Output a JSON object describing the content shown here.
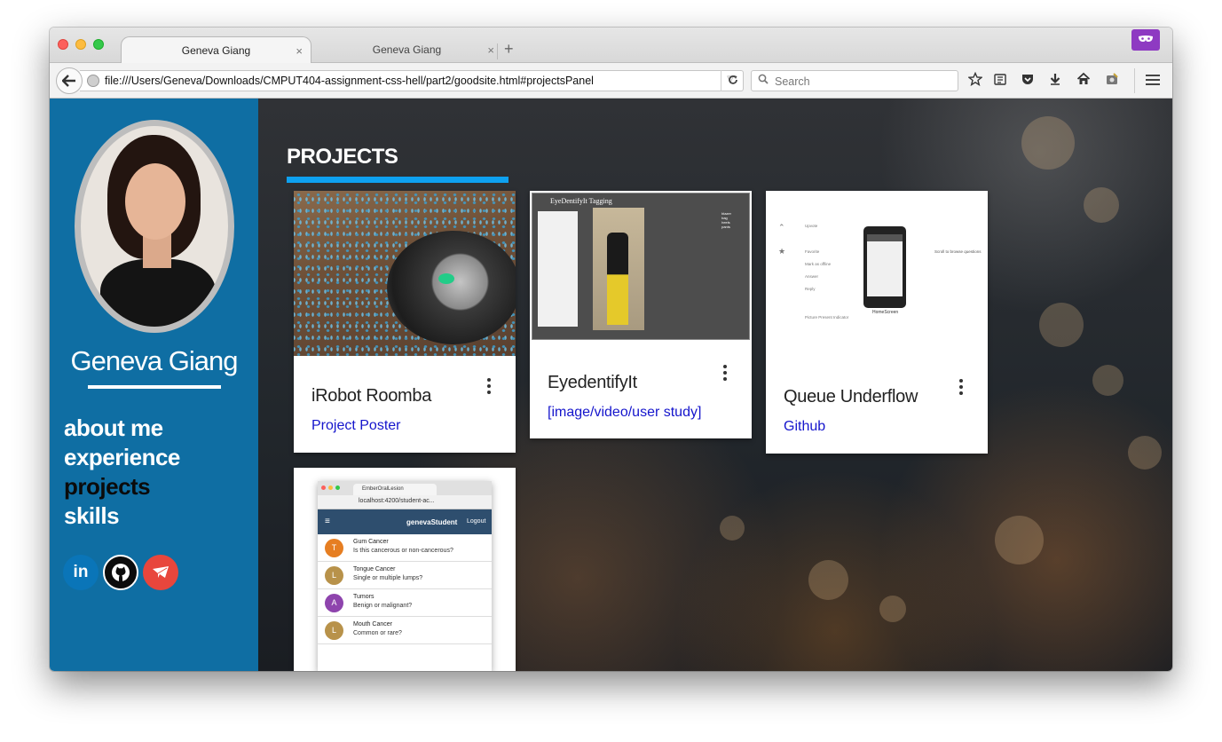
{
  "browser": {
    "tabs": [
      {
        "label": "Geneva Giang",
        "active": true
      },
      {
        "label": "Geneva Giang",
        "active": false
      }
    ],
    "new_tab_glyph": "+",
    "close_glyph": "×",
    "private_icon": "mask-icon",
    "url": "file:///Users/Geneva/Downloads/CMPUT404-assignment-css-hell/part2/goodsite.html#projectsPanel",
    "search_placeholder": "Search",
    "toolbar_icons": [
      "star-icon",
      "reading-list-icon",
      "pocket-icon",
      "download-icon",
      "home-icon",
      "screenshot-icon",
      "menu-icon"
    ]
  },
  "sidebar": {
    "name": "Geneva Giang",
    "nav": [
      {
        "label": "about me",
        "current": false
      },
      {
        "label": "experience",
        "current": false
      },
      {
        "label": "projects",
        "current": true
      },
      {
        "label": "skills",
        "current": false
      }
    ],
    "social": [
      {
        "icon": "linkedin-icon",
        "text": "in",
        "color": "#0a75b8"
      },
      {
        "icon": "github-icon",
        "text": "",
        "color": "#0c0c0c"
      },
      {
        "icon": "email-icon",
        "text": "",
        "color": "#e8463c"
      }
    ],
    "accent_color": "#0f6ea3"
  },
  "projects": {
    "heading": "PROJECTS",
    "accent_color": "#0ea1f0",
    "cards": [
      {
        "title": "iRobot Roomba",
        "link": "Project Poster"
      },
      {
        "title": "EyedentifyIt",
        "link": "[image/video/user study]"
      },
      {
        "title": "Queue Underflow",
        "link": "Github"
      },
      {
        "title": "",
        "link": ""
      }
    ]
  },
  "thumbnails": {
    "eyedentify": {
      "title": "EyeDentifyIt Tagging",
      "tags": [
        "blazer",
        "bag",
        "heels",
        "pants"
      ]
    },
    "queue": {
      "screen_label": "HomeScreen",
      "side_items": [
        "Upvote",
        "Favorite",
        "Mark as offline",
        "Answer",
        "Reply",
        "Picture Present Indicator"
      ],
      "note": "Scroll to browse questions"
    },
    "ember": {
      "tab": "EmberOralLesion",
      "address": "localhost:4200/student-ac...",
      "user": "genevaStudent",
      "logout": "Logout",
      "rows": [
        {
          "initial": "T",
          "title": "Gum Cancer",
          "question": "Is this cancerous or non-cancerous?",
          "color": "#e67e22"
        },
        {
          "initial": "L",
          "title": "Tongue Cancer",
          "question": "Single or multiple lumps?",
          "color": "#b8924a"
        },
        {
          "initial": "A",
          "title": "Tumors",
          "question": "Benign or malignant?",
          "color": "#8e44ad"
        },
        {
          "initial": "L",
          "title": "Mouth Cancer",
          "question": "Common or rare?",
          "color": "#b8924a"
        }
      ]
    }
  }
}
